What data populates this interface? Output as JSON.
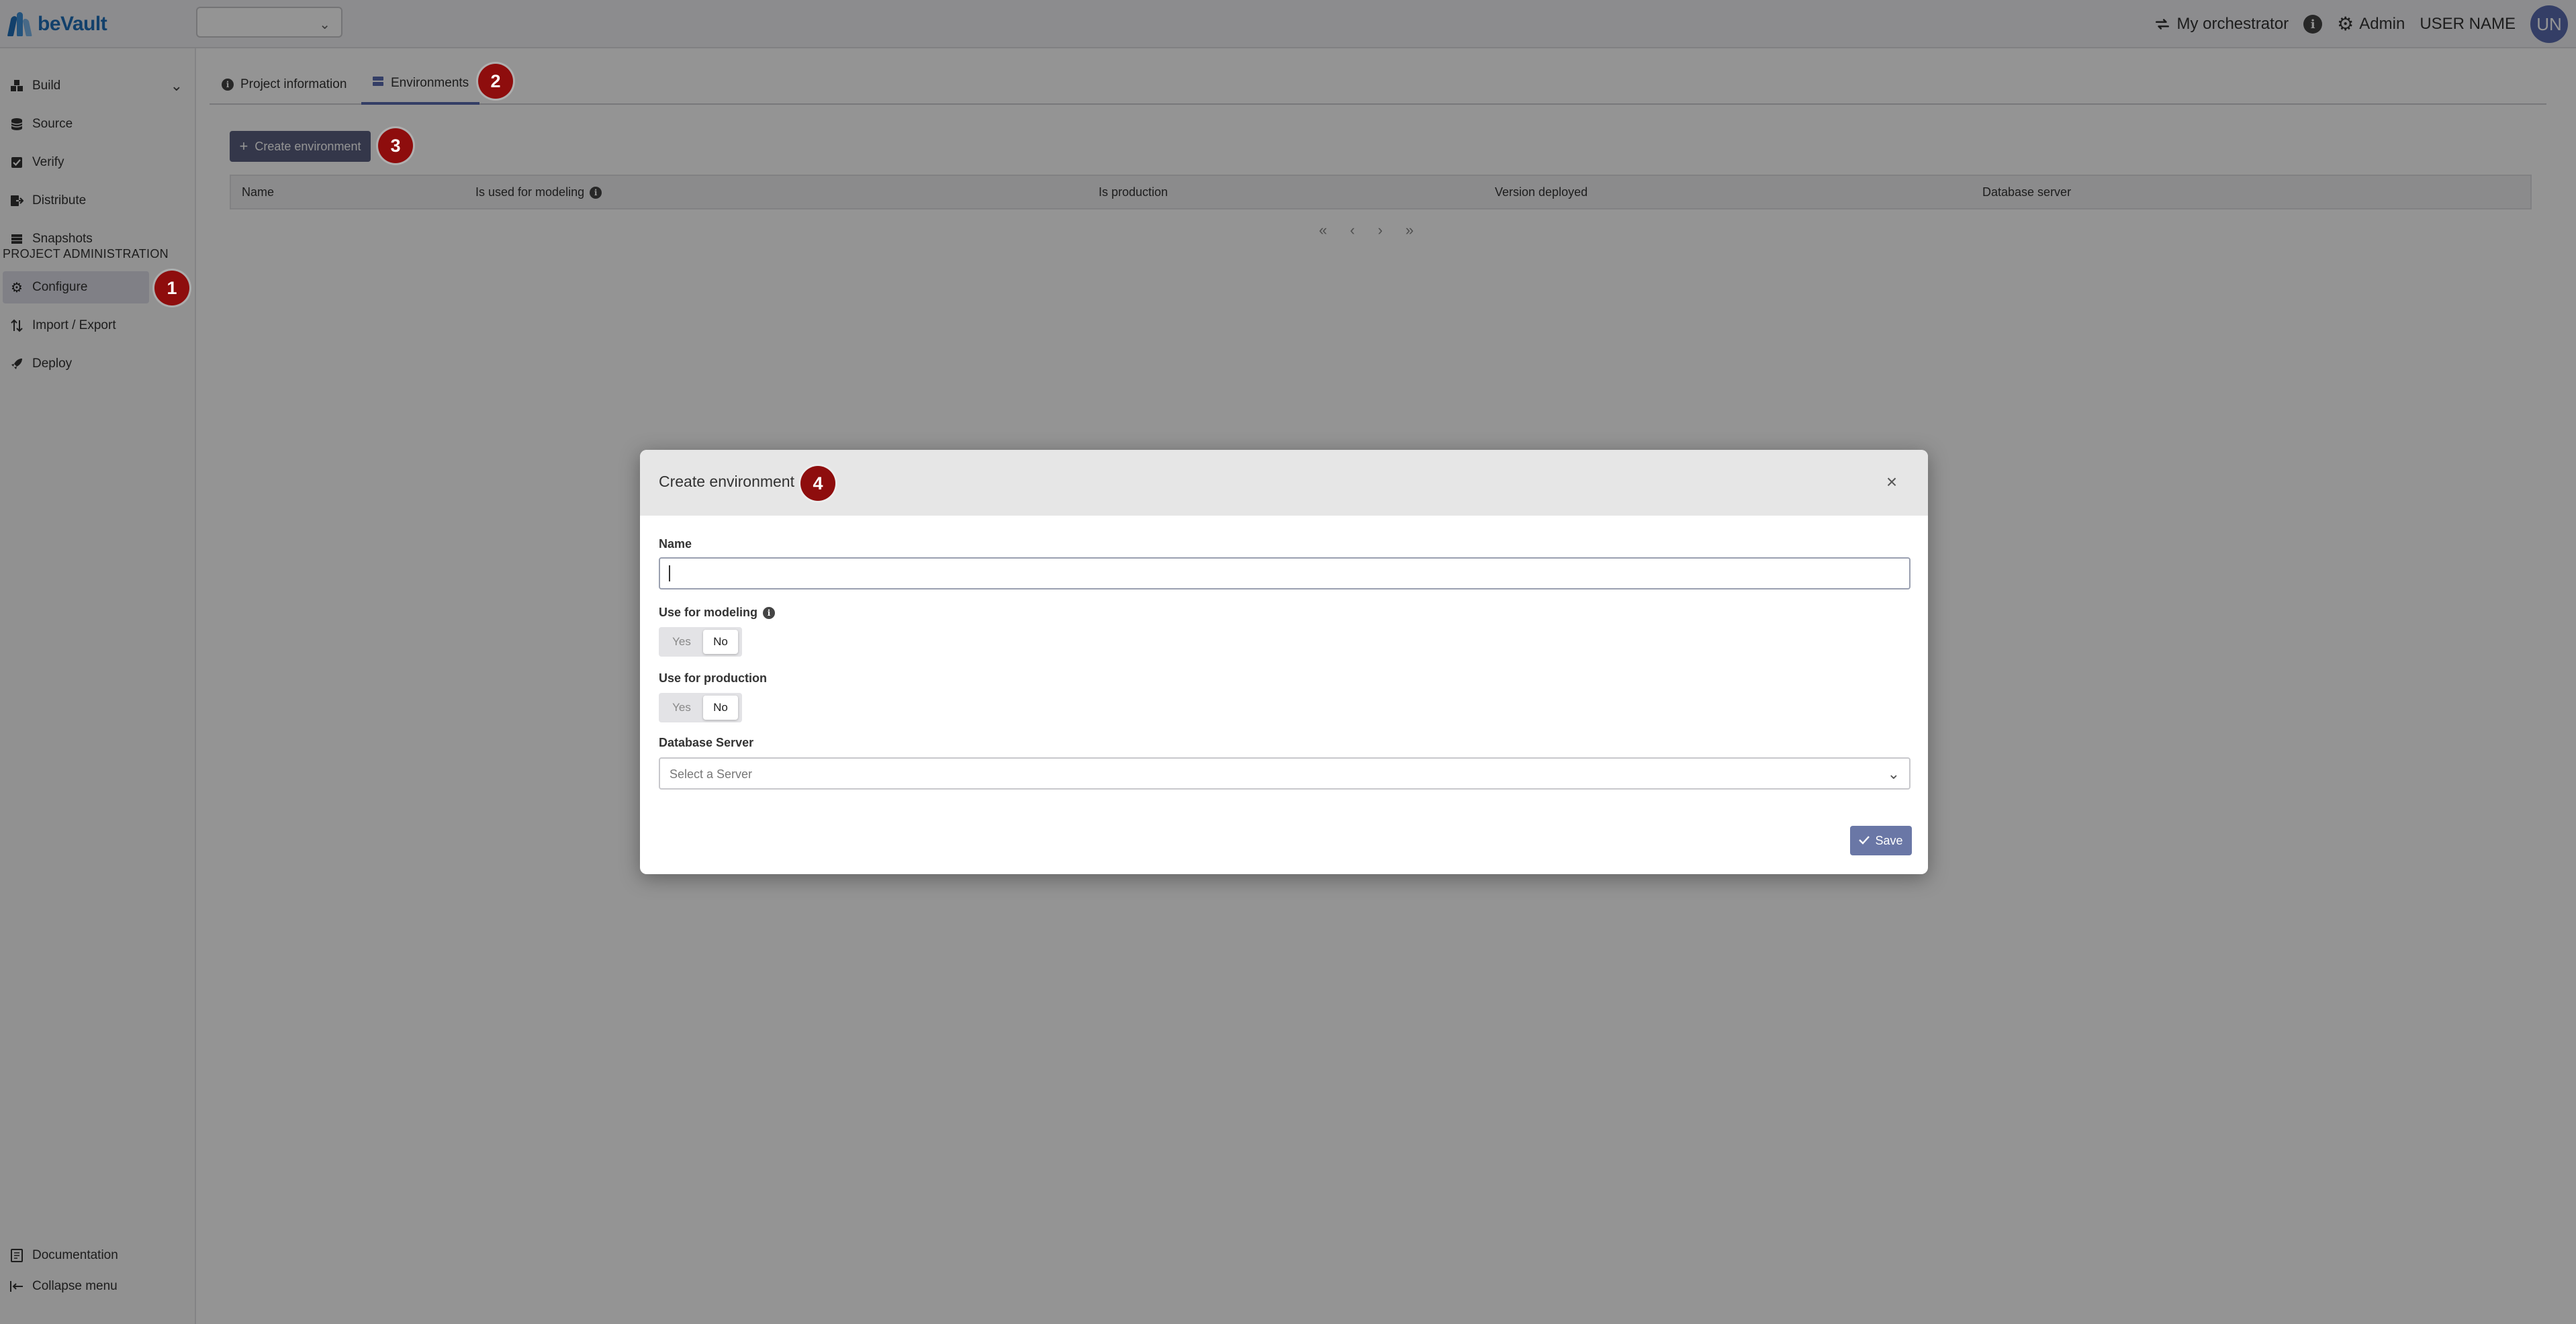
{
  "app": {
    "logo_text": "beVault"
  },
  "header": {
    "orchestrator_label": "My orchestrator",
    "admin_label": "Admin",
    "user_name": "USER NAME",
    "avatar_initials": "UN"
  },
  "sidebar": {
    "items": [
      {
        "label": "Build",
        "icon": "build-icon"
      },
      {
        "label": "Source",
        "icon": "database-icon"
      },
      {
        "label": "Verify",
        "icon": "check-square-icon"
      },
      {
        "label": "Distribute",
        "icon": "export-icon"
      },
      {
        "label": "Snapshots",
        "icon": "stack-icon"
      }
    ],
    "section_heading": "PROJECT ADMINISTRATION",
    "admin_items": [
      {
        "label": "Configure",
        "icon": "gear-icon",
        "active": true
      },
      {
        "label": "Import / Export",
        "icon": "arrows-updown-icon"
      },
      {
        "label": "Deploy",
        "icon": "rocket-icon"
      }
    ],
    "footer_items": [
      {
        "label": "Documentation",
        "icon": "book-icon"
      },
      {
        "label": "Collapse menu",
        "icon": "collapse-icon"
      }
    ]
  },
  "tabs": [
    {
      "label": "Project information",
      "icon": "info-icon",
      "active": false
    },
    {
      "label": "Environments",
      "icon": "layers-icon",
      "active": true
    }
  ],
  "toolbar": {
    "create_label": "Create environment"
  },
  "table": {
    "columns": [
      "Name",
      "Is used for modeling",
      "Is production",
      "Version deployed",
      "Database server"
    ],
    "rows": []
  },
  "pager": {
    "first": "«",
    "prev": "‹",
    "next": "›",
    "last": "»"
  },
  "callouts": [
    "1",
    "2",
    "3",
    "4"
  ],
  "modal": {
    "title": "Create environment",
    "name_label": "Name",
    "name_value": "",
    "modeling_label": "Use for modeling",
    "production_label": "Use for production",
    "yes_label": "Yes",
    "no_label": "No",
    "modeling_selected": "No",
    "production_selected": "No",
    "server_label": "Database Server",
    "server_placeholder": "Select a Server",
    "save_label": "Save"
  },
  "colors": {
    "brand": "#1f6fb8",
    "primary_button": "#5a6080",
    "save_button": "#6a77a6",
    "callout": "#8e0d0d",
    "avatar": "#5a6cb0"
  }
}
